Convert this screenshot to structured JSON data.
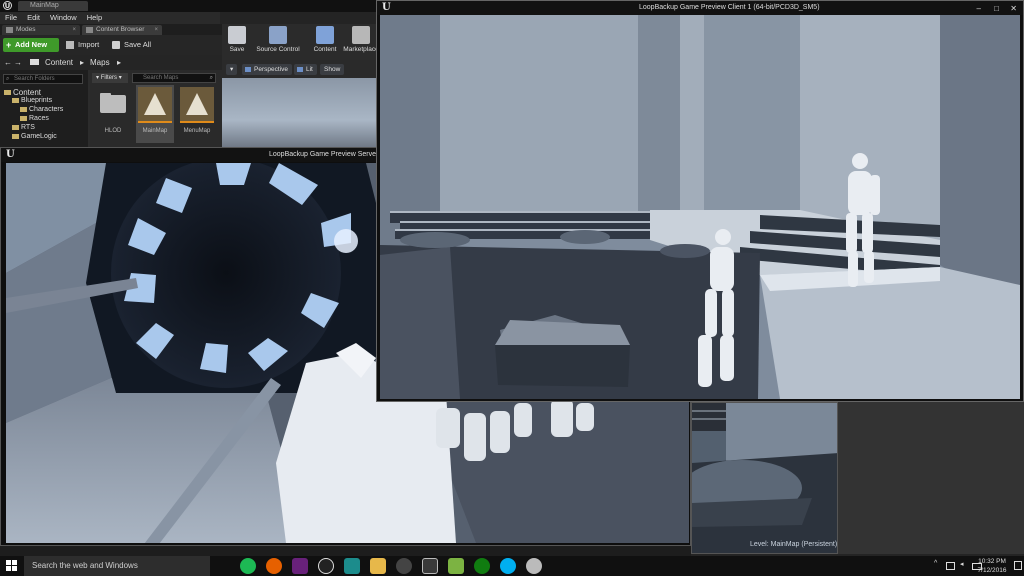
{
  "editor": {
    "project_tab": "MainMap",
    "menu": [
      "File",
      "Edit",
      "Window",
      "Help"
    ],
    "panel_tabs": [
      {
        "label": "Modes"
      },
      {
        "label": "Content Browser"
      }
    ],
    "close_glyph": "×"
  },
  "content_browser": {
    "add_new": "Add New",
    "import": "Import",
    "save_all": "Save All",
    "breadcrumb": [
      "Content",
      "Maps"
    ],
    "search_folders_placeholder": "Search Folders",
    "filters_label": "Filters",
    "search_maps_placeholder": "Search Maps",
    "tree": [
      {
        "label": "Content",
        "level": 0
      },
      {
        "label": "Blueprints",
        "level": 1
      },
      {
        "label": "Characters",
        "level": 2
      },
      {
        "label": "Races",
        "level": 2
      },
      {
        "label": "RTS",
        "level": 1
      },
      {
        "label": "GameLogic",
        "level": 1
      }
    ],
    "assets": [
      {
        "label": "HLOD",
        "kind": "folder-icon"
      },
      {
        "label": "MainMap",
        "kind": "map-icon"
      },
      {
        "label": "MenuMap",
        "kind": "map-icon"
      }
    ]
  },
  "toolbar": {
    "save": "Save",
    "source_control": "Source Control",
    "content": "Content",
    "marketplace": "Marketplace"
  },
  "viewport_bar": {
    "perspective": "Perspective",
    "lit": "Lit",
    "show": "Show"
  },
  "server_window": {
    "title": "LoopBackup Game Preview Server (64-"
  },
  "client_window": {
    "title": "LoopBackup Game Preview Client 1 (64-bit/PCD3D_SM5)",
    "controls": [
      "–",
      "□",
      "✕"
    ]
  },
  "level_label": "Level:  MainMap (Persistent)",
  "taskbar": {
    "search_placeholder": "Search the web and Windows",
    "apps": [
      "spotify-icon",
      "firefox-icon",
      "visual-studio-icon",
      "unreal-icon",
      "app-icon",
      "file-explorer-icon",
      "settings-icon",
      "epic-games-icon",
      "android-icon",
      "xbox-icon",
      "skype-icon",
      "steam-icon"
    ],
    "time": "10:32 PM",
    "date": "7/12/2016"
  },
  "colors": {
    "accent_green": "#3f9a2a",
    "ue_panel": "#2c2c2c",
    "scene_blue": "#8e9aaa"
  }
}
